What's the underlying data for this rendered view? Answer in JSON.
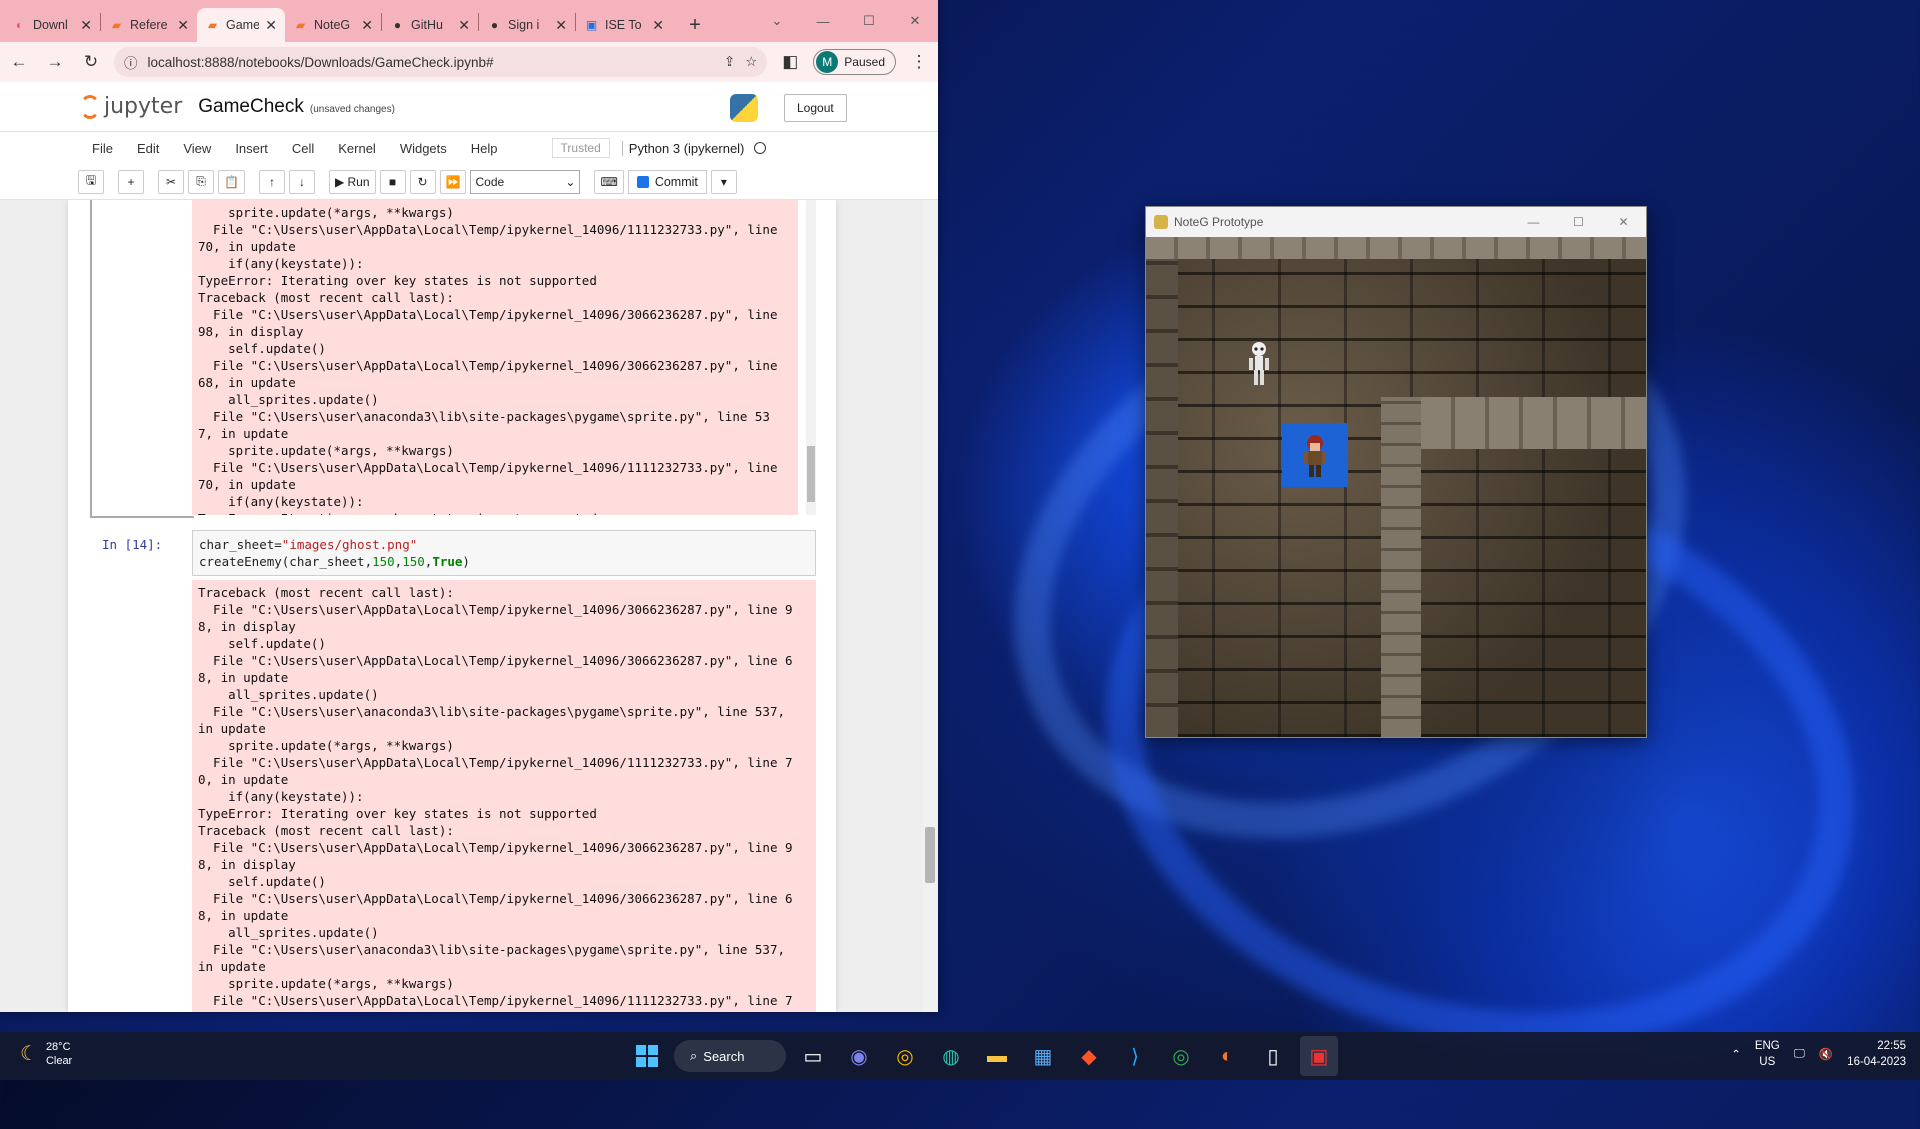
{
  "browser": {
    "tabs": [
      {
        "label": "Downl",
        "icon": "download-icon"
      },
      {
        "label": "Refere",
        "icon": "jupyter-icon"
      },
      {
        "label": "Game",
        "icon": "jupyter-icon",
        "active": true
      },
      {
        "label": "NoteG",
        "icon": "jupyter-icon"
      },
      {
        "label": "GitHu",
        "icon": "github-icon"
      },
      {
        "label": "Sign i",
        "icon": "github-icon"
      },
      {
        "label": "ISE To",
        "icon": "doc-icon"
      }
    ],
    "url": "localhost:8888/notebooks/Downloads/GameCheck.ipynb#",
    "profile_initial": "M",
    "profile_status": "Paused"
  },
  "jupyter": {
    "logo_text": "jupyter",
    "notebook_name": "GameCheck",
    "unsaved": "(unsaved changes)",
    "logout": "Logout",
    "menus": [
      "File",
      "Edit",
      "View",
      "Insert",
      "Cell",
      "Kernel",
      "Widgets",
      "Help"
    ],
    "trusted": "Trusted",
    "kernel": "Python 3 (ipykernel)",
    "toolbar": {
      "run": "Run",
      "cell_type": "Code",
      "commit": "Commit"
    }
  },
  "cells": {
    "output1": "    sprite.update(*args, **kwargs)\n  File \"C:\\Users\\user\\AppData\\Local\\Temp/ipykernel_14096/1111232733.py\", line\n70, in update\n    if(any(keystate)):\nTypeError: Iterating over key states is not supported\nTraceback (most recent call last):\n  File \"C:\\Users\\user\\AppData\\Local\\Temp/ipykernel_14096/3066236287.py\", line\n98, in display\n    self.update()\n  File \"C:\\Users\\user\\AppData\\Local\\Temp/ipykernel_14096/3066236287.py\", line\n68, in update\n    all_sprites.update()\n  File \"C:\\Users\\user\\anaconda3\\lib\\site-packages\\pygame\\sprite.py\", line 53\n7, in update\n    sprite.update(*args, **kwargs)\n  File \"C:\\Users\\user\\AppData\\Local\\Temp/ipykernel_14096/1111232733.py\", line\n70, in update\n    if(any(keystate)):\nTypeError: Iterating over key states is not supported",
    "prompt": "In [14]:",
    "code_line1_a": "char_sheet=",
    "code_line1_b": "\"images/ghost.png\"",
    "code_line2_a": "createEnemy(char_sheet,",
    "code_line2_b": "150",
    "code_line2_c": ",",
    "code_line2_d": "150",
    "code_line2_e": ",",
    "code_line2_f": "True",
    "code_line2_g": ")",
    "output2": "Traceback (most recent call last):\n  File \"C:\\Users\\user\\AppData\\Local\\Temp/ipykernel_14096/3066236287.py\", line 9\n8, in display\n    self.update()\n  File \"C:\\Users\\user\\AppData\\Local\\Temp/ipykernel_14096/3066236287.py\", line 6\n8, in update\n    all_sprites.update()\n  File \"C:\\Users\\user\\anaconda3\\lib\\site-packages\\pygame\\sprite.py\", line 537,\nin update\n    sprite.update(*args, **kwargs)\n  File \"C:\\Users\\user\\AppData\\Local\\Temp/ipykernel_14096/1111232733.py\", line 7\n0, in update\n    if(any(keystate)):\nTypeError: Iterating over key states is not supported\nTraceback (most recent call last):\n  File \"C:\\Users\\user\\AppData\\Local\\Temp/ipykernel_14096/3066236287.py\", line 9\n8, in display\n    self.update()\n  File \"C:\\Users\\user\\AppData\\Local\\Temp/ipykernel_14096/3066236287.py\", line 6\n8, in update\n    all_sprites.update()\n  File \"C:\\Users\\user\\anaconda3\\lib\\site-packages\\pygame\\sprite.py\", line 537,\nin update\n    sprite.update(*args, **kwargs)\n  File \"C:\\Users\\user\\AppData\\Local\\Temp/ipykernel_14096/1111232733.py\", line 7"
  },
  "game_window": {
    "title": "NoteG Prototype"
  },
  "taskbar": {
    "weather_temp": "28°C",
    "weather_desc": "Clear",
    "search": "Search",
    "lang_top": "ENG",
    "lang_bottom": "US",
    "time": "22:55",
    "date": "16-04-2023"
  },
  "colors": {
    "accent": "#f37726",
    "tab_strip": "#f5b3bd",
    "error_bg": "#ffdddd",
    "player_bg": "#1e63d6"
  }
}
